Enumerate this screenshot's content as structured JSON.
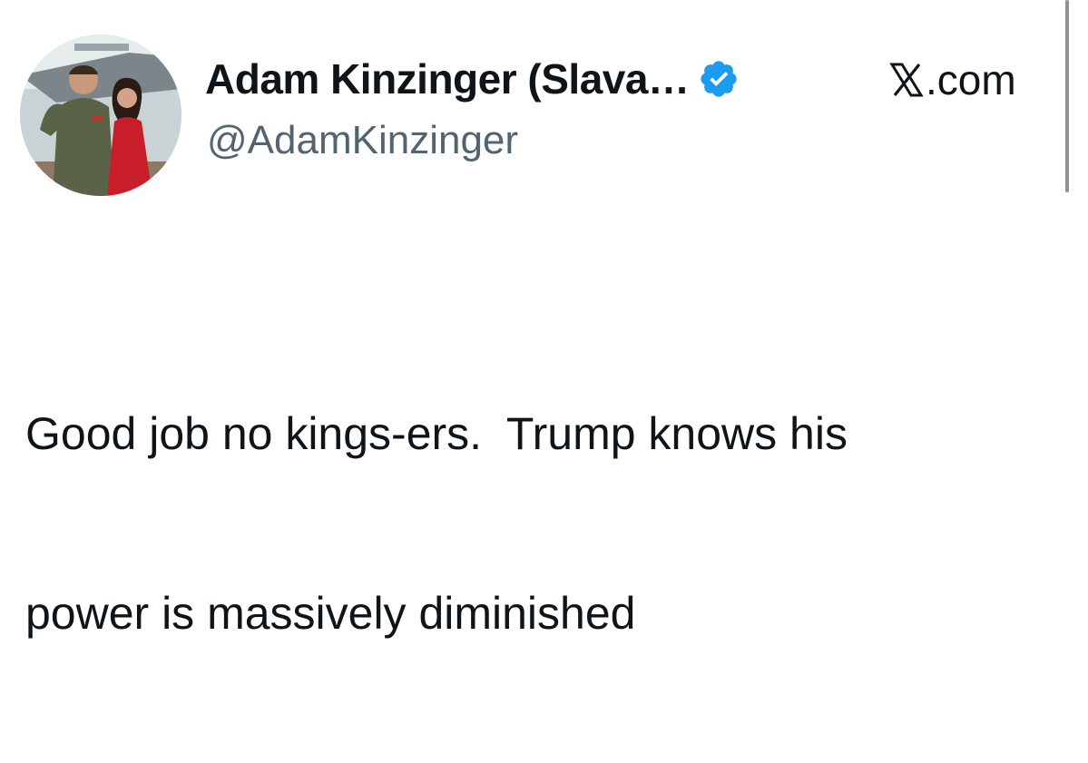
{
  "tweet": {
    "author": {
      "display_name": "Adam Kinzinger (Slava…",
      "handle": "@AdamKinzinger",
      "verified": true,
      "verified_color": "#1d9bf0"
    },
    "source": {
      "logo_icon": "x-logo-icon",
      "label": ".com"
    },
    "text_line_1": "Good job no kings-ers.  Trump knows his",
    "text_line_2": "power is massively diminished"
  },
  "colors": {
    "text_primary": "#0f1419",
    "text_secondary": "#536471",
    "verified_blue": "#1d9bf0"
  }
}
